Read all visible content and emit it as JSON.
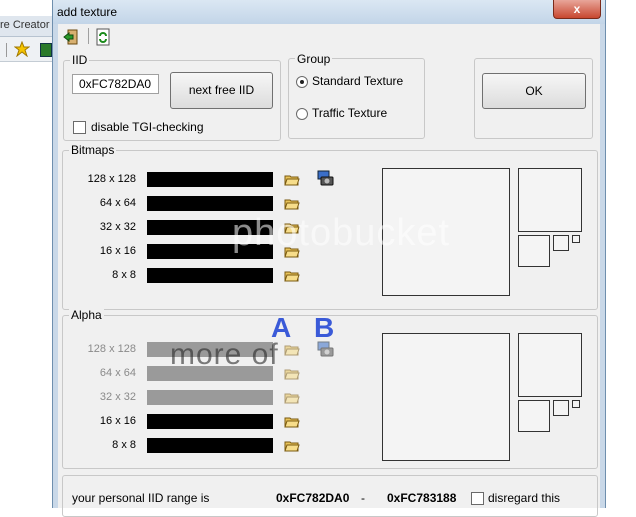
{
  "background_app": {
    "partial_title": "re Creator"
  },
  "window": {
    "title": "add texture",
    "close_glyph": "x"
  },
  "toolbar": {
    "icons": [
      "exit-icon",
      "refresh-icon"
    ]
  },
  "iid": {
    "group_label": "IID",
    "value": "0xFC782DA0",
    "next_button": "next free IID",
    "disable_tgi_label": "disable TGI-checking",
    "disable_tgi_checked": false
  },
  "group": {
    "group_label": "Group",
    "options": [
      {
        "label": "Standard Texture",
        "selected": true
      },
      {
        "label": "Traffic Texture",
        "selected": false
      }
    ]
  },
  "ok_button": "OK",
  "bitmaps": {
    "group_label": "Bitmaps",
    "sizes": [
      "128 x 128",
      "64 x 64",
      "32 x 32",
      "16 x 16",
      "8 x 8"
    ]
  },
  "alpha": {
    "group_label": "Alpha",
    "sizes": [
      "128 x 128",
      "64 x 64",
      "32 x 32",
      "16 x 16",
      "8 x 8"
    ],
    "markers": {
      "a": "A",
      "b": "B"
    }
  },
  "footer": {
    "range_label": "your personal IID range is",
    "range_start": "0xFC782DA0",
    "range_sep": "-",
    "range_end": "0xFC783188",
    "disregard_label": "disregard this",
    "disregard_checked": false
  },
  "watermark": {
    "brand": "photobucket",
    "tagline": "more of"
  }
}
